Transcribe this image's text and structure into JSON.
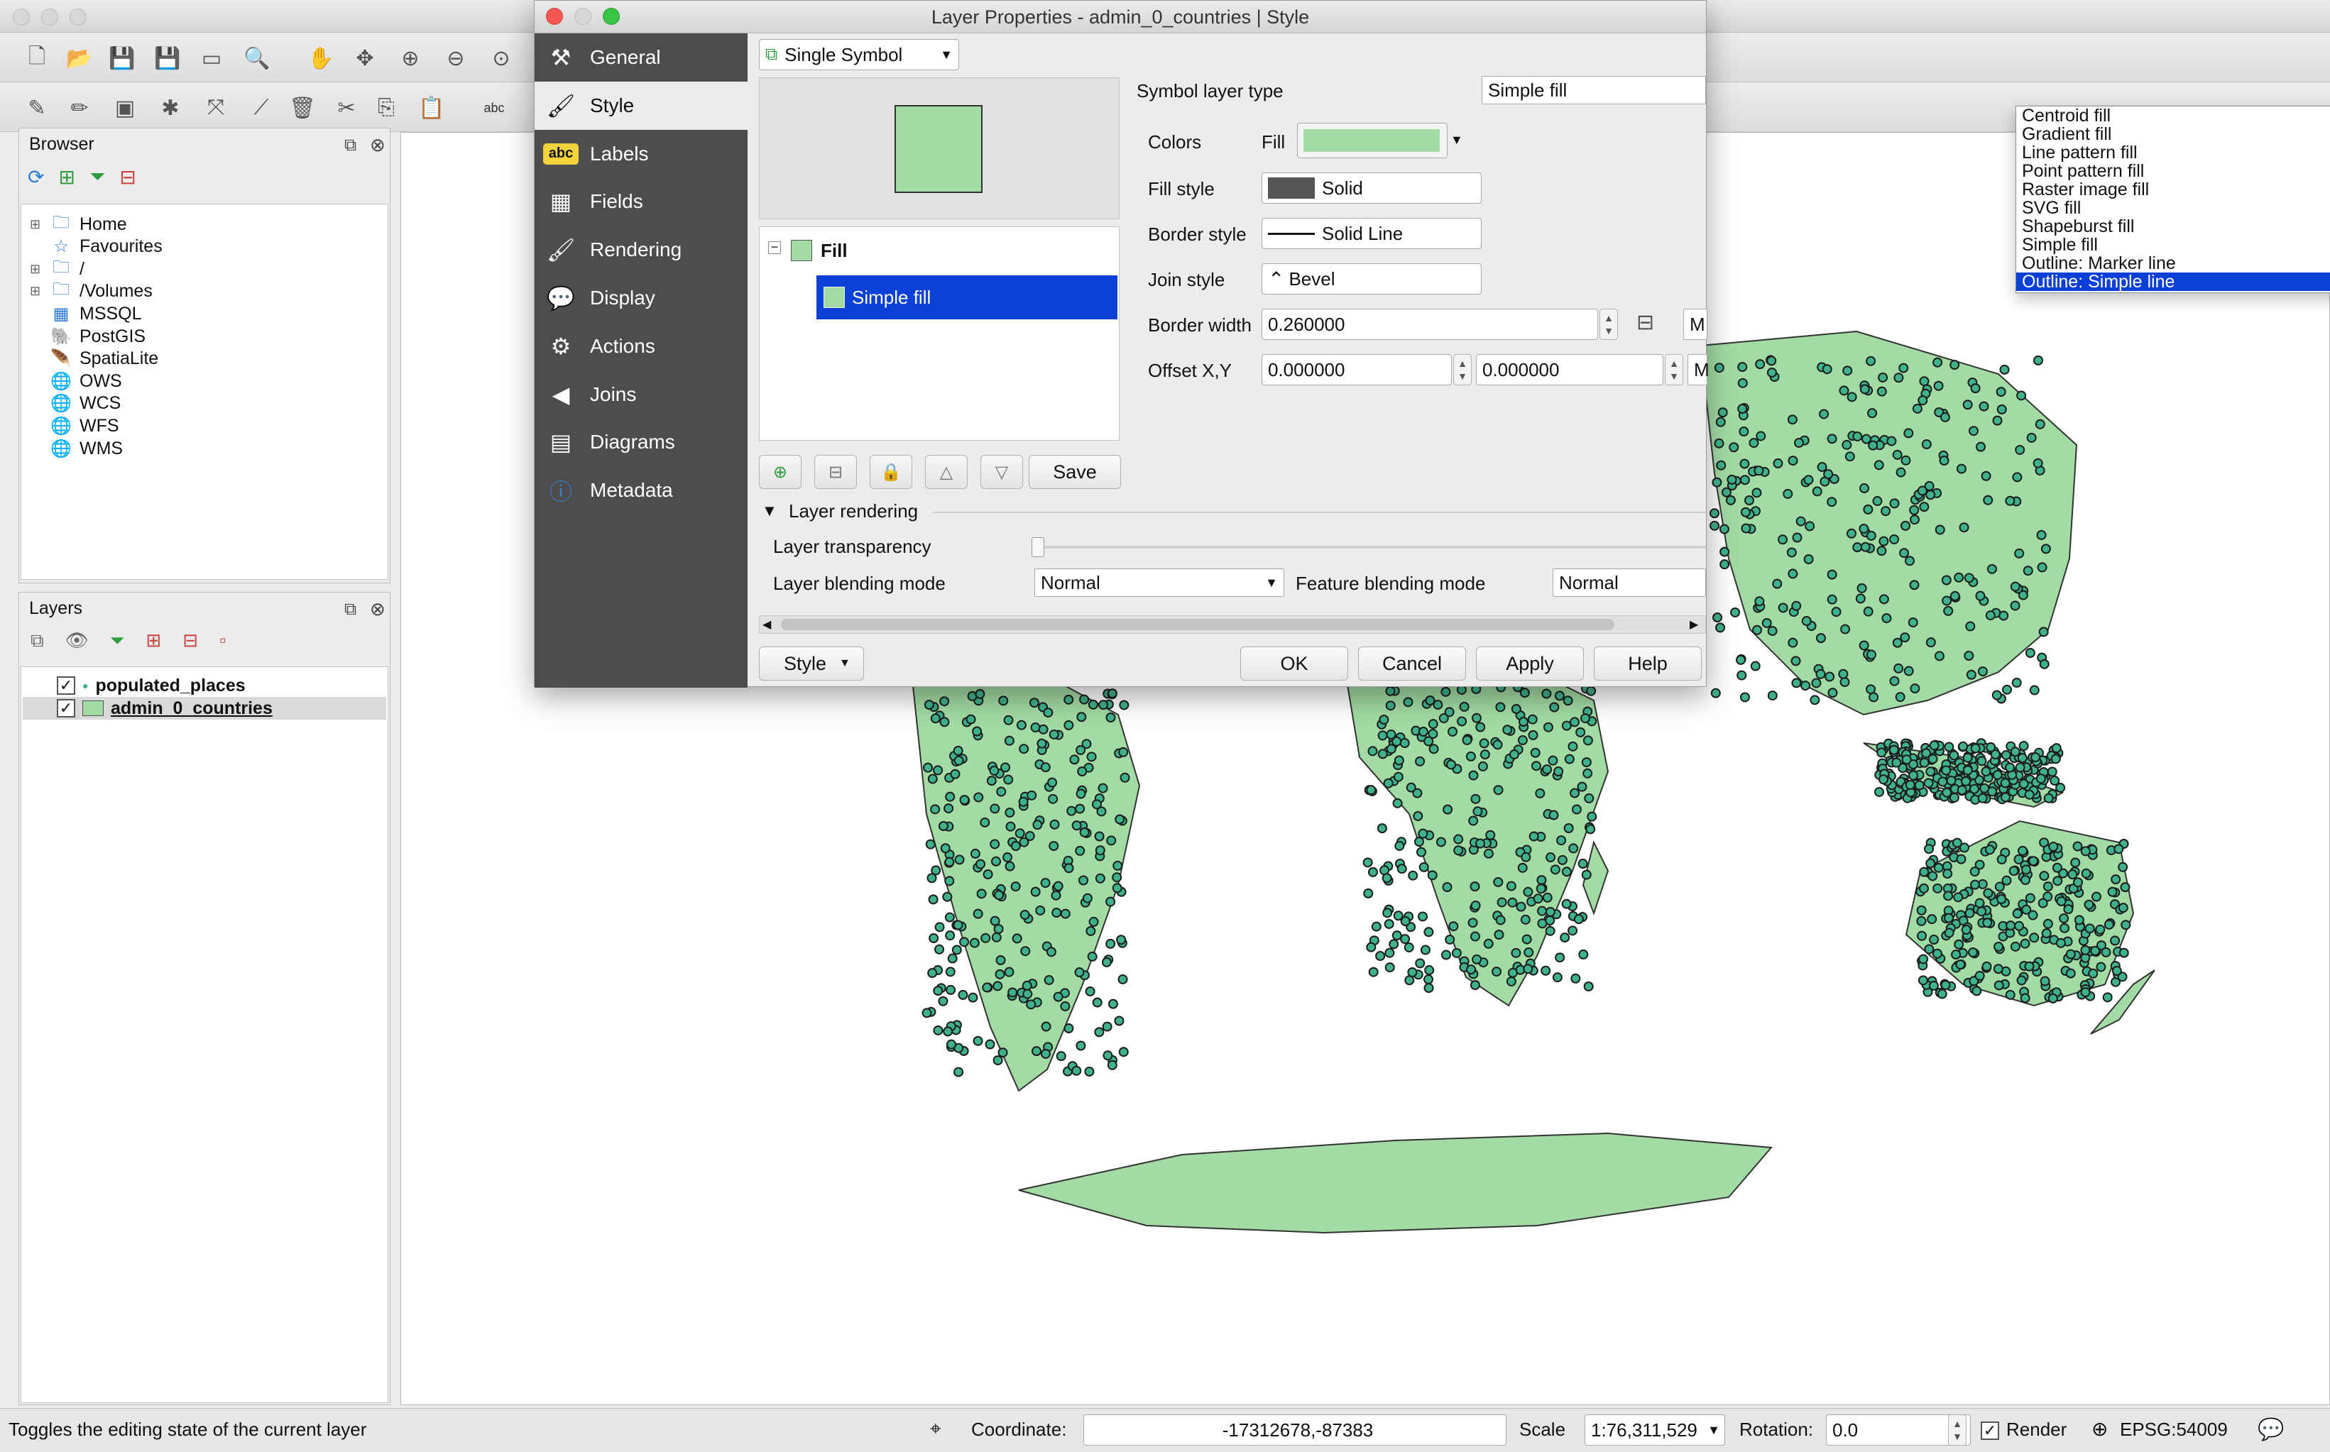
{
  "dialog": {
    "title": "Layer Properties - admin_0_countries | Style",
    "sidebar": [
      {
        "label": "General",
        "icon": "tools-icon"
      },
      {
        "label": "Style",
        "icon": "brush-icon"
      },
      {
        "label": "Labels",
        "icon": "abc-label-icon"
      },
      {
        "label": "Fields",
        "icon": "table-icon"
      },
      {
        "label": "Rendering",
        "icon": "paintbrush-icon"
      },
      {
        "label": "Display",
        "icon": "speech-bubble-icon"
      },
      {
        "label": "Actions",
        "icon": "gear-icon"
      },
      {
        "label": "Joins",
        "icon": "join-icon"
      },
      {
        "label": "Diagrams",
        "icon": "diagram-icon"
      },
      {
        "label": "Metadata",
        "icon": "info-icon"
      }
    ],
    "renderer": "Single Symbol",
    "symbol_tree": {
      "fill": "Fill",
      "simple_fill": "Simple fill"
    },
    "save_label": "Save",
    "symbol_layer_type_label": "Symbol layer type",
    "symbol_layer_type_value": "Simple fill",
    "dropdown_options": [
      "Centroid fill",
      "Gradient fill",
      "Line pattern fill",
      "Point pattern fill",
      "Raster image fill",
      "SVG fill",
      "Shapeburst fill",
      "Simple fill",
      "Outline: Marker line",
      "Outline: Simple line"
    ],
    "dropdown_selected": "Outline: Simple line",
    "colors_label": "Colors",
    "fill_label": "Fill",
    "fill_color": "#a3dba4",
    "fill_style_label": "Fill style",
    "fill_style_value": "Solid",
    "border_style_label": "Border style",
    "border_style_value": "Solid Line",
    "join_style_label": "Join style",
    "join_style_value": "Bevel",
    "border_width_label": "Border width",
    "border_width_value": "0.260000",
    "offset_label": "Offset X,Y",
    "offset_x": "0.000000",
    "offset_y": "0.000000",
    "unit_label": "M",
    "layer_rendering_label": "Layer rendering",
    "layer_transparency_label": "Layer transparency",
    "layer_blending_label": "Layer blending mode",
    "layer_blending_value": "Normal",
    "feature_blending_label": "Feature blending mode",
    "feature_blending_value": "Normal",
    "style_btn": "Style",
    "ok_btn": "OK",
    "cancel_btn": "Cancel",
    "apply_btn": "Apply",
    "help_btn": "Help"
  },
  "browser": {
    "title": "Browser",
    "items": [
      "Home",
      "Favourites",
      "/",
      "/Volumes",
      "MSSQL",
      "PostGIS",
      "SpatiaLite",
      "OWS",
      "WCS",
      "WFS",
      "WMS"
    ]
  },
  "layers": {
    "title": "Layers",
    "items": [
      {
        "name": "populated_places",
        "checked": true
      },
      {
        "name": "admin_0_countries",
        "checked": true
      }
    ]
  },
  "status": {
    "message": "Toggles the editing state of the current layer",
    "coordinate_label": "Coordinate:",
    "coordinate_value": "-17312678,-87383",
    "scale_label": "Scale",
    "scale_value": "1:76,311,529",
    "rotation_label": "Rotation:",
    "rotation_value": "0.0",
    "render_label": "Render",
    "crs": "EPSG:54009"
  },
  "colors": {
    "accent": "#0a3fd8",
    "land": "#a3dba4",
    "point": "#3fb28b"
  }
}
